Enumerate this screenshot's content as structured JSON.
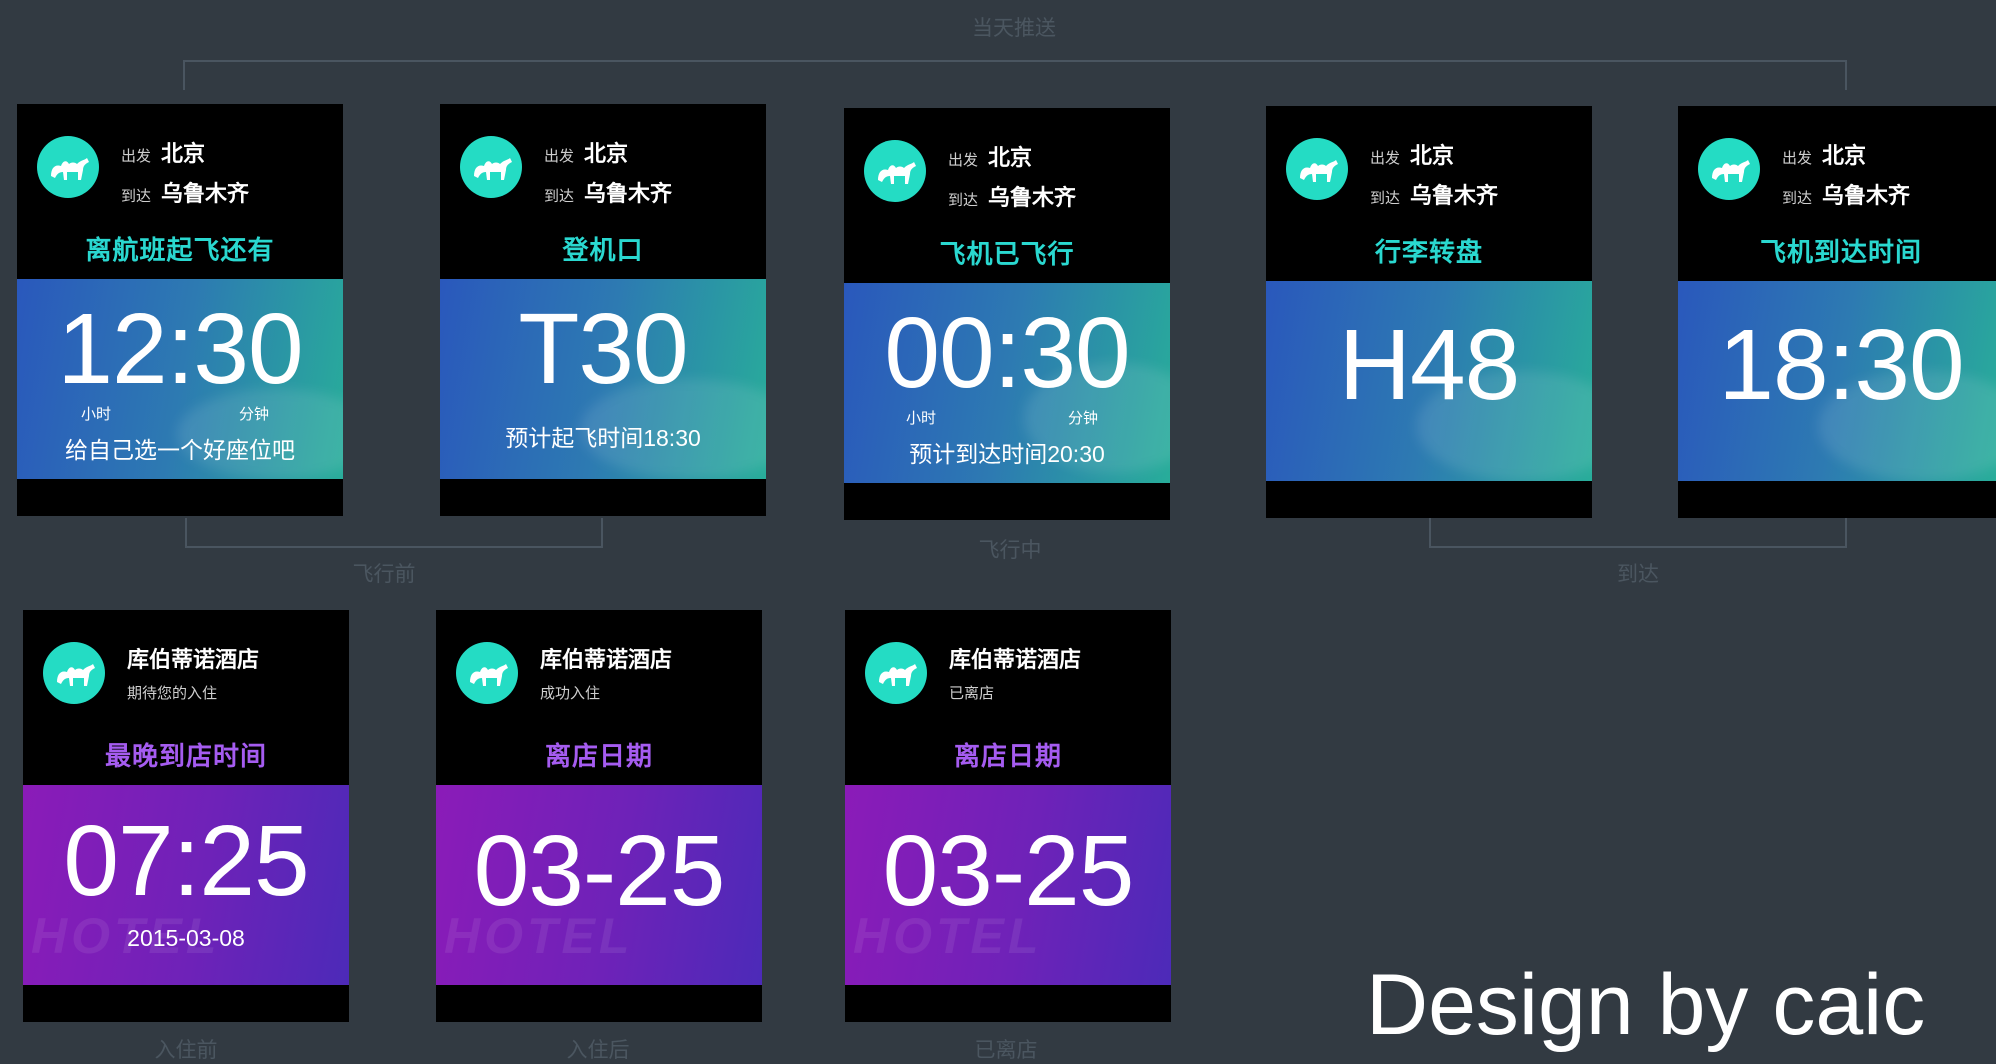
{
  "groups": {
    "same_day": "当天推送",
    "before_flight": "飞行前",
    "in_flight": "飞行中",
    "arrival": "到达",
    "before_checkin": "入住前",
    "after_checkin": "入住后",
    "checked_out": "已离店"
  },
  "flight_cards": [
    {
      "depart_label": "出发",
      "depart_city": "北京",
      "arrive_label": "到达",
      "arrive_city": "乌鲁木齐",
      "subtitle": "离航班起飞还有",
      "big": "12:30",
      "unit_left": "小时",
      "unit_right": "分钟",
      "note": "给自己选一个好座位吧"
    },
    {
      "depart_label": "出发",
      "depart_city": "北京",
      "arrive_label": "到达",
      "arrive_city": "乌鲁木齐",
      "subtitle": "登机口",
      "big": "T30",
      "note": "预计起飞时间18:30"
    },
    {
      "depart_label": "出发",
      "depart_city": "北京",
      "arrive_label": "到达",
      "arrive_city": "乌鲁木齐",
      "subtitle": "飞机已飞行",
      "big": "00:30",
      "unit_left": "小时",
      "unit_right": "分钟",
      "note": "预计到达时间20:30"
    },
    {
      "depart_label": "出发",
      "depart_city": "北京",
      "arrive_label": "到达",
      "arrive_city": "乌鲁木齐",
      "subtitle": "行李转盘",
      "big": "H48"
    },
    {
      "depart_label": "出发",
      "depart_city": "北京",
      "arrive_label": "到达",
      "arrive_city": "乌鲁木齐",
      "subtitle": "飞机到达时间",
      "big": "18:30"
    }
  ],
  "hotel_cards": [
    {
      "name": "库伯蒂诺酒店",
      "status": "期待您的入住",
      "subtitle": "最晚到店时间",
      "big": "07:25",
      "note": "2015-03-08"
    },
    {
      "name": "库伯蒂诺酒店",
      "status": "成功入住",
      "subtitle": "离店日期",
      "big": "03-25"
    },
    {
      "name": "库伯蒂诺酒店",
      "status": "已离店",
      "subtitle": "离店日期",
      "big": "03-25"
    }
  ],
  "watermark": "HOTEL",
  "credit": "Design by caic",
  "icons": {
    "logo": "camel-icon"
  },
  "colors": {
    "background": "#323a42",
    "accent_teal": "#2ad8d0",
    "accent_purple": "#a55cf0",
    "logo": "#24dcc4"
  }
}
